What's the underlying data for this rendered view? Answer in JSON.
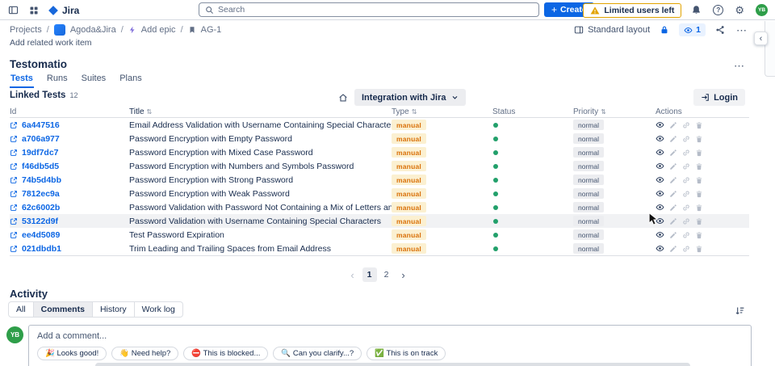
{
  "navbar": {
    "app_name": "Jira",
    "search": {
      "placeholder": "Search"
    },
    "create_label": "Create",
    "limited_users_label": "Limited users left",
    "avatar_initials": "YB"
  },
  "breadcrumb": {
    "projects": "Projects",
    "separator": "/",
    "project_name": "Agoda&Jira",
    "add_epic": "Add epic",
    "issue_key": "AG-1",
    "standard_layout": "Standard layout",
    "watch_count": "1"
  },
  "scrolled_text": "Add related work item",
  "testomatio": {
    "title": "Testomatio",
    "tabs": [
      "Tests",
      "Runs",
      "Suites",
      "Plans"
    ],
    "active_tab": "Tests",
    "linked_tests_label": "Linked Tests",
    "linked_tests_count": "12",
    "integration_dropdown_label": "Integration with Jira",
    "login_label": "Login",
    "table": {
      "headers": {
        "id": "Id",
        "title": "Title",
        "type": "Type",
        "status": "Status",
        "priority": "Priority",
        "actions": "Actions"
      },
      "rows": [
        {
          "id": "6a447516",
          "title": "Email Address Validation with Username Containing Special Characters",
          "type": "manual",
          "status": "green",
          "priority": "normal"
        },
        {
          "id": "a706a977",
          "title": "Password Encryption with Empty Password",
          "type": "manual",
          "status": "green",
          "priority": "normal"
        },
        {
          "id": "19df7dc7",
          "title": "Password Encryption with Mixed Case Password",
          "type": "manual",
          "status": "green",
          "priority": "normal"
        },
        {
          "id": "f46db5d5",
          "title": "Password Encryption with Numbers and Symbols Password",
          "type": "manual",
          "status": "green",
          "priority": "normal"
        },
        {
          "id": "74b5d4bb",
          "title": "Password Encryption with Strong Password",
          "type": "manual",
          "status": "green",
          "priority": "normal"
        },
        {
          "id": "7812ec9a",
          "title": "Password Encryption with Weak Password",
          "type": "manual",
          "status": "green",
          "priority": "normal"
        },
        {
          "id": "62c6002b",
          "title": "Password Validation with Password Not Containing a Mix of Letters and Numbers",
          "type": "manual",
          "status": "green",
          "priority": "normal"
        },
        {
          "id": "53122d9f",
          "title": "Password Validation with Username Containing Special Characters",
          "type": "manual",
          "status": "green",
          "priority": "normal",
          "highlighted": true
        },
        {
          "id": "ee4d5089",
          "title": "Test Password Expiration",
          "type": "manual",
          "status": "green",
          "priority": "normal"
        },
        {
          "id": "021dbdb1",
          "title": "Trim Leading and Trailing Spaces from Email Address",
          "type": "manual",
          "status": "green",
          "priority": "normal"
        }
      ]
    },
    "pagination": {
      "pages": [
        "1",
        "2"
      ],
      "current": "1"
    }
  },
  "activity": {
    "title": "Activity",
    "tabs": [
      "All",
      "Comments",
      "History",
      "Work log"
    ],
    "active_tab": "Comments",
    "comment_placeholder": "Add a comment...",
    "comment_avatar_initials": "YB",
    "quick_replies": [
      "🎉 Looks good!",
      "👋 Need help?",
      "⛔ This is blocked...",
      "🔍 Can you clarify...?",
      "✅ This is on track"
    ]
  },
  "icons": {
    "plus": "+",
    "help": "?",
    "gear": "⚙",
    "more": "⋯",
    "sort": "⇅",
    "prev": "‹",
    "next": "›",
    "collapse": "‹"
  },
  "colors": {
    "accent": "#0C66E4",
    "status_green": "#22A06B",
    "avatar_green": "#2E9E49",
    "warning_yellow": "#E2A300",
    "type_badge_bg": "#FBF0D1",
    "type_badge_text": "#D97008",
    "priority_badge_bg": "#ECEDF0",
    "priority_badge_text": "#44546F"
  }
}
